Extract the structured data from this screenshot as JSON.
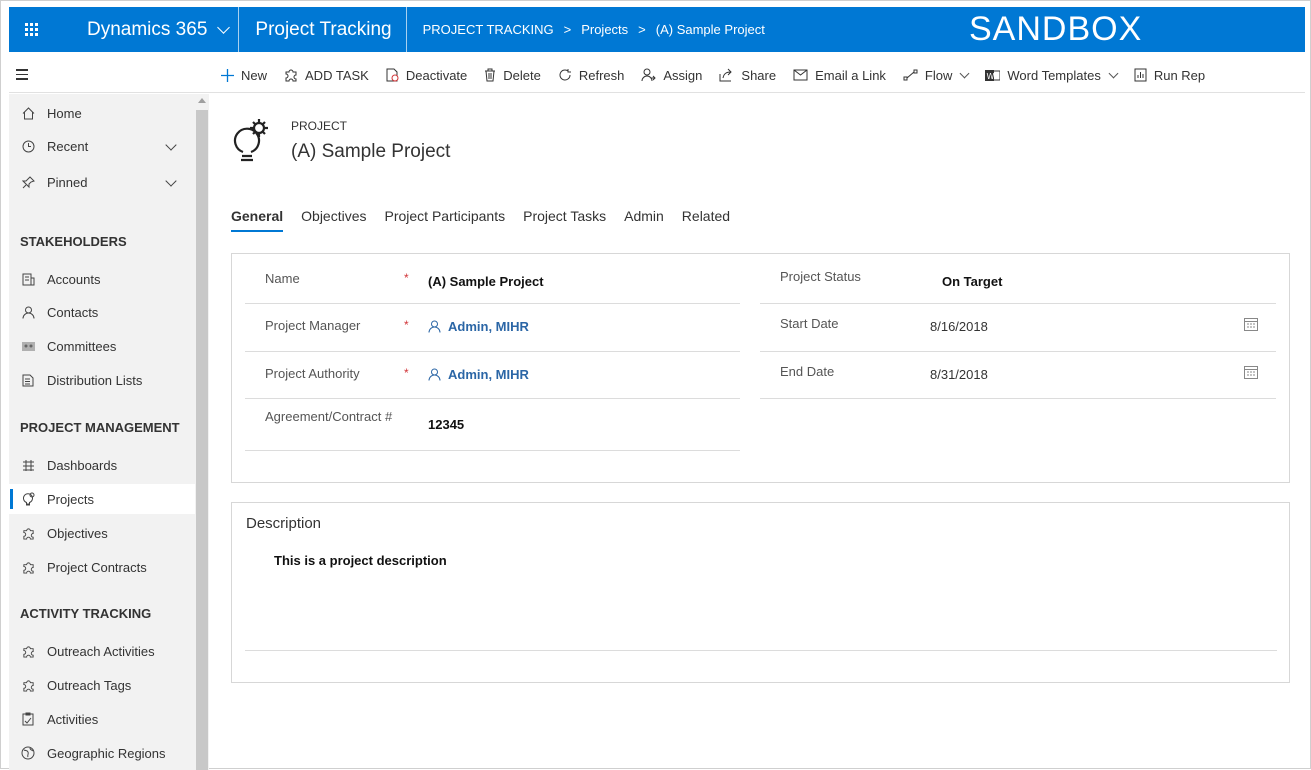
{
  "topbar": {
    "app_name": "Dynamics 365",
    "module": "Project Tracking",
    "breadcrumb": [
      "PROJECT TRACKING",
      "Projects",
      "(A) Sample Project"
    ],
    "breadcrumb_separator": ">",
    "environment": "SANDBOX",
    "bg_color": "#0078d4"
  },
  "commands": [
    {
      "label": "New",
      "icon": "plus-icon"
    },
    {
      "label": "ADD TASK",
      "icon": "puzzle-icon"
    },
    {
      "label": "Deactivate",
      "icon": "deactivate-icon"
    },
    {
      "label": "Delete",
      "icon": "trash-icon"
    },
    {
      "label": "Refresh",
      "icon": "refresh-icon"
    },
    {
      "label": "Assign",
      "icon": "assign-icon"
    },
    {
      "label": "Share",
      "icon": "share-icon"
    },
    {
      "label": "Email a Link",
      "icon": "email-link-icon"
    },
    {
      "label": "Flow",
      "icon": "flow-icon",
      "dropdown": true
    },
    {
      "label": "Word Templates",
      "icon": "word-icon",
      "dropdown": true
    },
    {
      "label": "Run Rep",
      "icon": "report-icon"
    }
  ],
  "sidebar": {
    "top_items": [
      {
        "label": "Home",
        "icon": "home-icon"
      },
      {
        "label": "Recent",
        "icon": "clock-icon",
        "expandable": true
      },
      {
        "label": "Pinned",
        "icon": "pin-icon",
        "expandable": true
      }
    ],
    "groups": [
      {
        "heading": "STAKEHOLDERS",
        "items": [
          {
            "label": "Accounts",
            "icon": "accounts-icon"
          },
          {
            "label": "Contacts",
            "icon": "person-icon"
          },
          {
            "label": "Committees",
            "icon": "committees-icon"
          },
          {
            "label": "Distribution Lists",
            "icon": "list-icon"
          }
        ]
      },
      {
        "heading": "PROJECT MANAGEMENT",
        "items": [
          {
            "label": "Dashboards",
            "icon": "dashboard-icon"
          },
          {
            "label": "Projects",
            "icon": "lightbulb-icon",
            "selected": true
          },
          {
            "label": "Objectives",
            "icon": "puzzle-icon"
          },
          {
            "label": "Project Contracts",
            "icon": "puzzle-icon"
          }
        ]
      },
      {
        "heading": "ACTIVITY TRACKING",
        "items": [
          {
            "label": "Outreach Activities",
            "icon": "puzzle-icon"
          },
          {
            "label": "Outreach Tags",
            "icon": "puzzle-icon"
          },
          {
            "label": "Activities",
            "icon": "clipboard-icon"
          },
          {
            "label": "Geographic Regions",
            "icon": "globe-icon"
          }
        ]
      }
    ]
  },
  "record": {
    "entity": "PROJECT",
    "name": "(A) Sample Project",
    "icon": "lightbulb-gear-icon"
  },
  "tabs": [
    "General",
    "Objectives",
    "Project Participants",
    "Project Tasks",
    "Admin",
    "Related"
  ],
  "active_tab": "General",
  "form": {
    "left": [
      {
        "label": "Name",
        "required": "*",
        "value": "(A) Sample Project",
        "type": "text"
      },
      {
        "label": "Project Manager",
        "required": "*",
        "value": "Admin, MIHR",
        "type": "lookup"
      },
      {
        "label": "Project Authority",
        "required": "*",
        "value": "Admin, MIHR",
        "type": "lookup"
      },
      {
        "label": "Agreement/Contract #",
        "required": "",
        "value": "12345",
        "type": "text"
      }
    ],
    "right": [
      {
        "label": "Project Status",
        "value": "On Target",
        "type": "bold"
      },
      {
        "label": "Start Date",
        "value": "8/16/2018",
        "type": "date"
      },
      {
        "label": "End Date",
        "value": "8/31/2018",
        "type": "date"
      }
    ]
  },
  "description": {
    "title": "Description",
    "text": "This is a project description"
  },
  "colors": {
    "accent": "#0078d4",
    "lookup": "#2b66a6",
    "required": "#d13438"
  }
}
